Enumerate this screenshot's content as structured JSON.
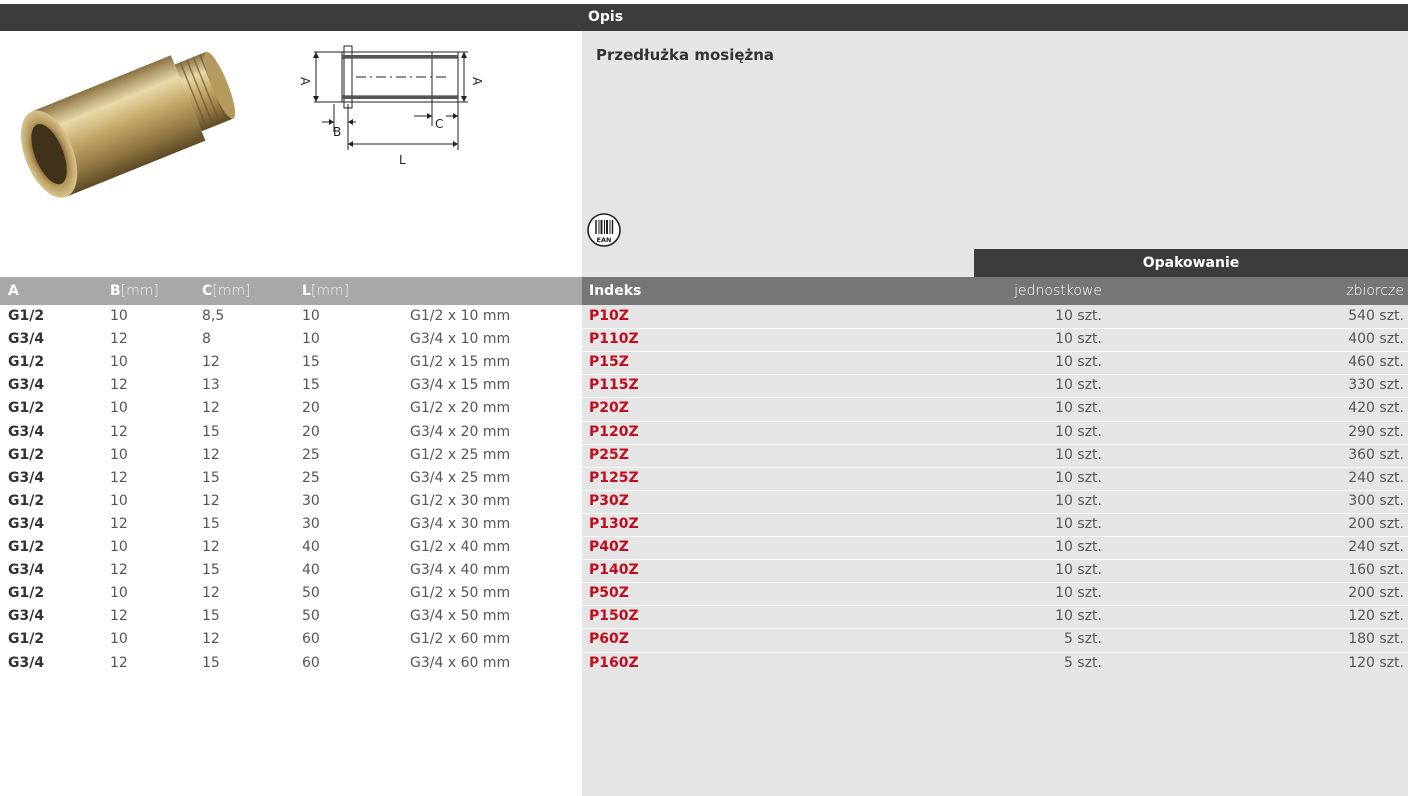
{
  "header": {
    "title": "Opis"
  },
  "description": "Przedłużka mosiężna",
  "drawing_labels": {
    "a_left": "A",
    "a_right": "A",
    "b": "B",
    "c": "C",
    "l": "L"
  },
  "ean_label": "EAN",
  "packaging_header": "Opakowanie",
  "columns": {
    "a": "A",
    "b": "B",
    "b_unit": "[mm]",
    "c": "C",
    "c_unit": "[mm]",
    "l": "L",
    "l_unit": "[mm]",
    "index": "Indeks",
    "unit_pack": "jednostkowe",
    "bulk_pack": "zbiorcze"
  },
  "rows": [
    {
      "a": "G1/2",
      "b": "10",
      "c": "8,5",
      "l": "10",
      "desc": "G1/2 x 10 mm",
      "index": "P10Z",
      "unit": "10 szt.",
      "bulk": "540 szt."
    },
    {
      "a": "G3/4",
      "b": "12",
      "c": "8",
      "l": "10",
      "desc": "G3/4 x 10 mm",
      "index": "P110Z",
      "unit": "10 szt.",
      "bulk": "400 szt."
    },
    {
      "a": "G1/2",
      "b": "10",
      "c": "12",
      "l": "15",
      "desc": "G1/2 x 15 mm",
      "index": "P15Z",
      "unit": "10 szt.",
      "bulk": "460 szt."
    },
    {
      "a": "G3/4",
      "b": "12",
      "c": "13",
      "l": "15",
      "desc": "G3/4 x 15 mm",
      "index": "P115Z",
      "unit": "10 szt.",
      "bulk": "330 szt."
    },
    {
      "a": "G1/2",
      "b": "10",
      "c": "12",
      "l": "20",
      "desc": "G1/2 x 20 mm",
      "index": "P20Z",
      "unit": "10 szt.",
      "bulk": "420 szt."
    },
    {
      "a": "G3/4",
      "b": "12",
      "c": "15",
      "l": "20",
      "desc": "G3/4 x 20 mm",
      "index": "P120Z",
      "unit": "10 szt.",
      "bulk": "290 szt."
    },
    {
      "a": "G1/2",
      "b": "10",
      "c": "12",
      "l": "25",
      "desc": "G1/2 x 25 mm",
      "index": "P25Z",
      "unit": "10 szt.",
      "bulk": "360 szt."
    },
    {
      "a": "G3/4",
      "b": "12",
      "c": "15",
      "l": "25",
      "desc": "G3/4 x 25 mm",
      "index": "P125Z",
      "unit": "10 szt.",
      "bulk": "240 szt."
    },
    {
      "a": "G1/2",
      "b": "10",
      "c": "12",
      "l": "30",
      "desc": "G1/2 x 30 mm",
      "index": "P30Z",
      "unit": "10 szt.",
      "bulk": "300 szt."
    },
    {
      "a": "G3/4",
      "b": "12",
      "c": "15",
      "l": "30",
      "desc": "G3/4 x 30 mm",
      "index": "P130Z",
      "unit": "10 szt.",
      "bulk": "200 szt."
    },
    {
      "a": "G1/2",
      "b": "10",
      "c": "12",
      "l": "40",
      "desc": "G1/2 x 40 mm",
      "index": "P40Z",
      "unit": "10 szt.",
      "bulk": "240 szt."
    },
    {
      "a": "G3/4",
      "b": "12",
      "c": "15",
      "l": "40",
      "desc": "G3/4 x 40 mm",
      "index": "P140Z",
      "unit": "10 szt.",
      "bulk": "160 szt."
    },
    {
      "a": "G1/2",
      "b": "10",
      "c": "12",
      "l": "50",
      "desc": "G1/2 x 50 mm",
      "index": "P50Z",
      "unit": "10 szt.",
      "bulk": "200 szt."
    },
    {
      "a": "G3/4",
      "b": "12",
      "c": "15",
      "l": "50",
      "desc": "G3/4 x 50 mm",
      "index": "P150Z",
      "unit": "10 szt.",
      "bulk": "120 szt."
    },
    {
      "a": "G1/2",
      "b": "10",
      "c": "12",
      "l": "60",
      "desc": "G1/2 x 60 mm",
      "index": "P60Z",
      "unit": "5 szt.",
      "bulk": "180 szt."
    },
    {
      "a": "G3/4",
      "b": "12",
      "c": "15",
      "l": "60",
      "desc": "G3/4 x 60 mm",
      "index": "P160Z",
      "unit": "5 szt.",
      "bulk": "120 szt."
    }
  ],
  "colors": {
    "index": "#c00d1e",
    "header_dark": "#3c3c3c",
    "panel": "#e5e5e5"
  }
}
